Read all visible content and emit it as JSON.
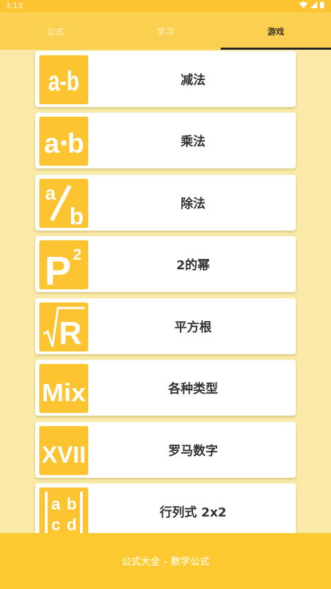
{
  "status_bar": {
    "time": "3:13"
  },
  "tabs": [
    {
      "label": "公式"
    },
    {
      "label": "学习"
    },
    {
      "label": "游戏"
    }
  ],
  "games": [
    {
      "label": "减法",
      "icon": "subtraction-icon"
    },
    {
      "label": "乘法",
      "icon": "multiplication-icon"
    },
    {
      "label": "除法",
      "icon": "division-icon"
    },
    {
      "label": "2的幂",
      "icon": "power-icon"
    },
    {
      "label": "平方根",
      "icon": "square-root-icon"
    },
    {
      "label": "各种类型",
      "icon": "mix-icon"
    },
    {
      "label": "罗马数字",
      "icon": "roman-numerals-icon"
    },
    {
      "label": "行列式 2x2",
      "icon": "determinant-icon"
    }
  ],
  "tile_glyphs": {
    "subtraction": "a-b",
    "multiplication_a": "a",
    "multiplication_b": "b",
    "division_a": "a",
    "division_b": "b",
    "power_base": "P",
    "power_exp": "2",
    "root": "R",
    "mix": "Mix",
    "roman": "XVII",
    "det_a": "a",
    "det_b": "b",
    "det_c": "c",
    "det_d": "d"
  },
  "footer": {
    "text": "公式大全 - 数学公式"
  },
  "colors": {
    "accent": "#fbc430",
    "background": "#f9eba7",
    "card": "#ffffff",
    "text": "#333333"
  }
}
